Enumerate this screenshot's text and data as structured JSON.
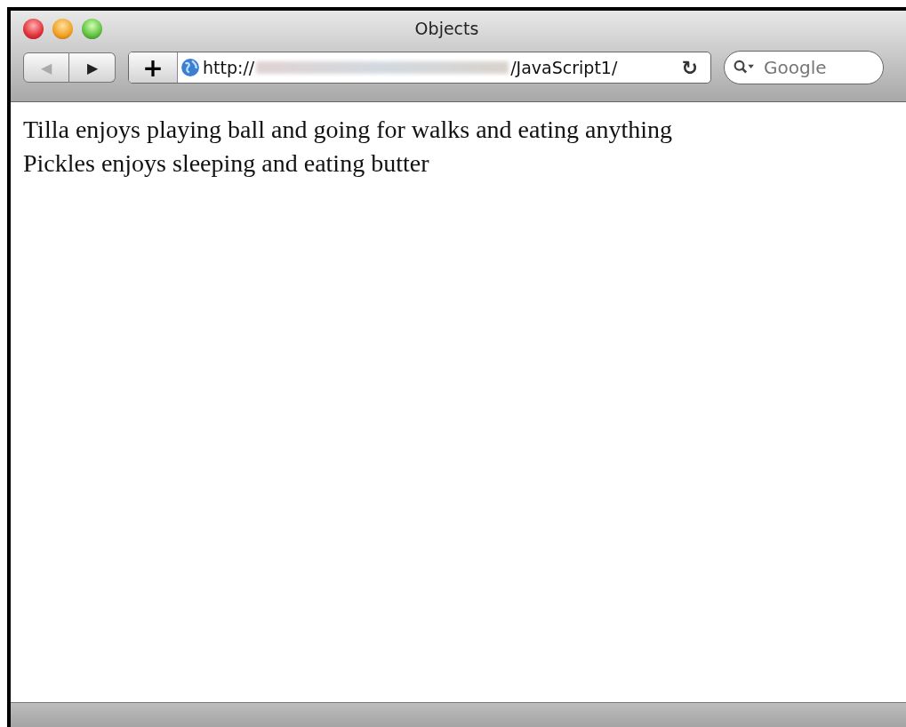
{
  "window": {
    "title": "Objects"
  },
  "toolbar": {
    "back": {
      "glyph": "◀",
      "disabled": true
    },
    "forward": {
      "glyph": "▶",
      "disabled": false
    },
    "add": "+",
    "address": {
      "scheme": "http://",
      "path": "/JavaScript1/"
    },
    "reload": "↻",
    "search": {
      "placeholder": "Google"
    }
  },
  "content": {
    "lines": [
      "Tilla enjoys playing ball and going for walks and eating anything",
      "Pickles enjoys sleeping and eating butter"
    ]
  }
}
